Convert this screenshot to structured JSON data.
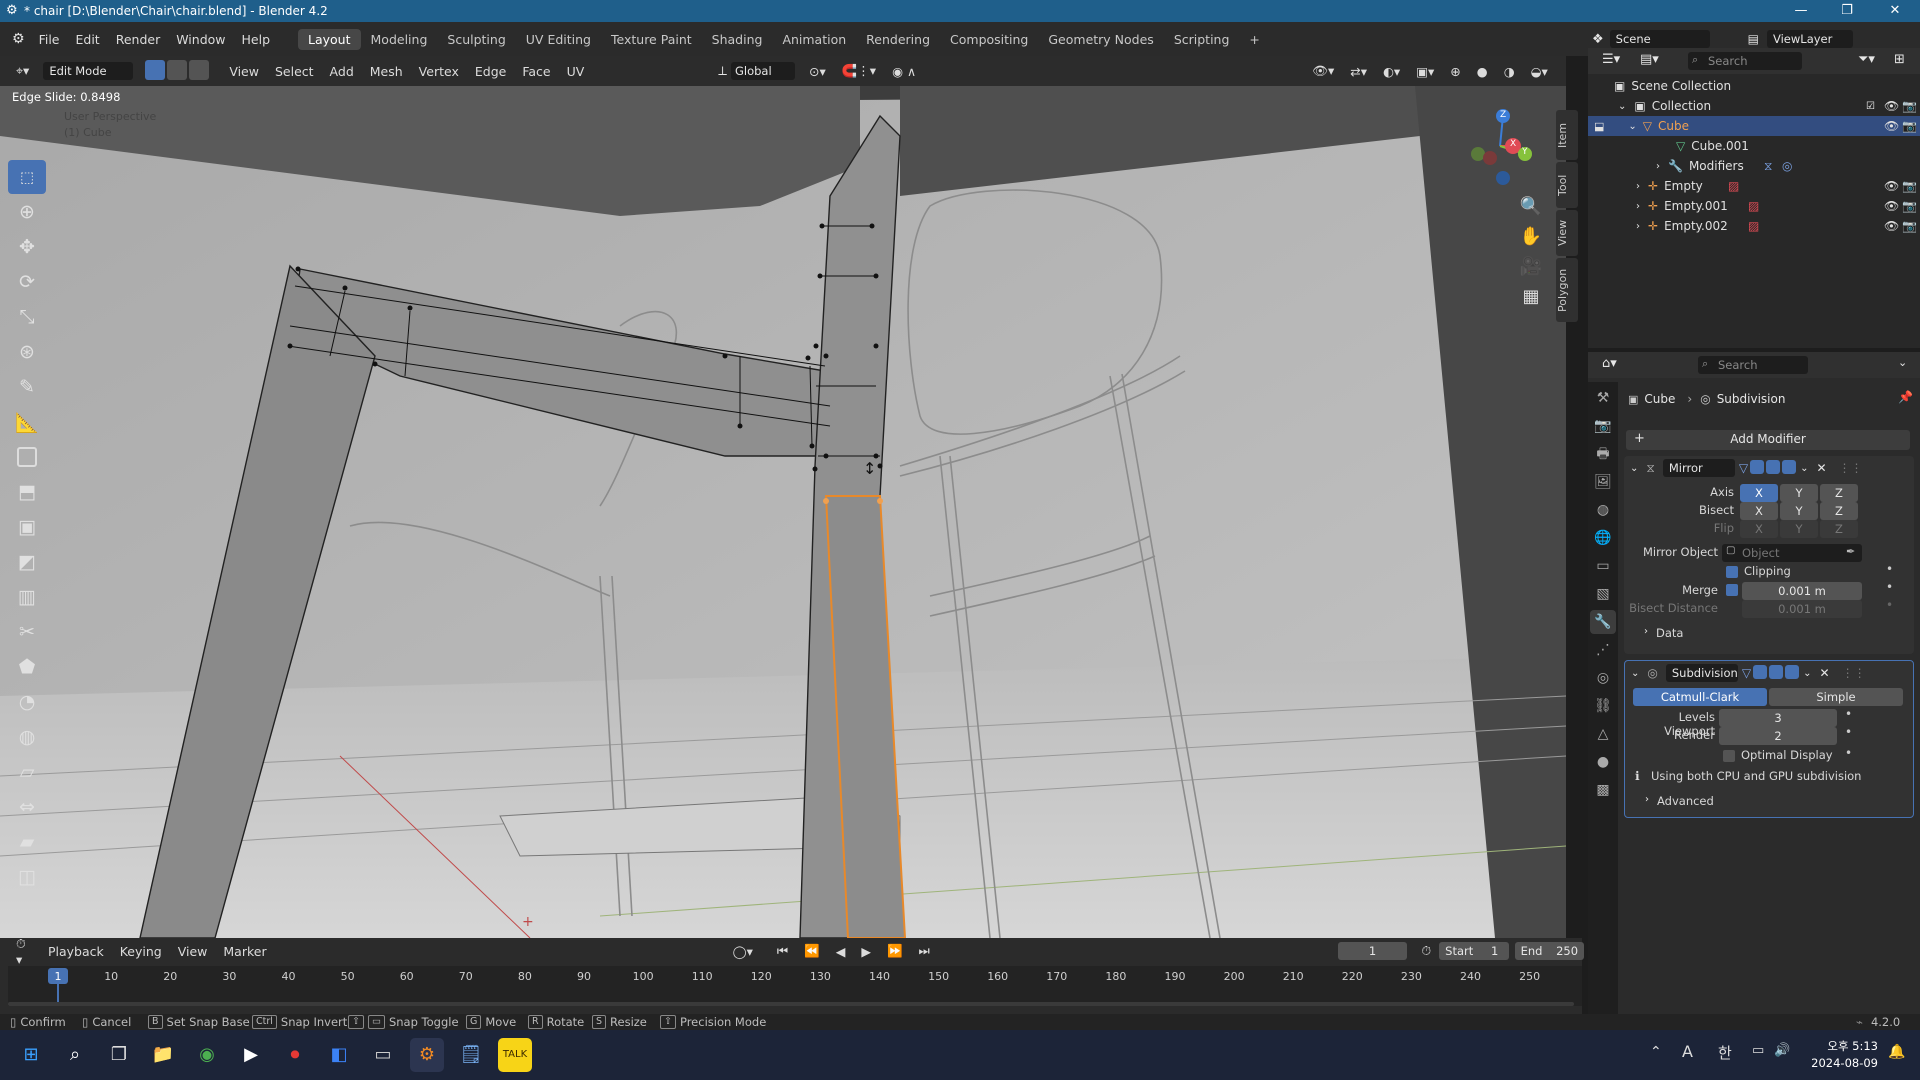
{
  "title_bar": {
    "title": "* chair [D:\\Blender\\Chair\\chair.blend] - Blender 4.2",
    "minimize": "—",
    "maximize": "❐",
    "close": "✕"
  },
  "menu": [
    "File",
    "Edit",
    "Render",
    "Window",
    "Help"
  ],
  "workspaces": [
    "Layout",
    "Modeling",
    "Sculpting",
    "UV Editing",
    "Texture Paint",
    "Shading",
    "Animation",
    "Rendering",
    "Compositing",
    "Geometry Nodes",
    "Scripting"
  ],
  "add_workspace": "+",
  "scene": {
    "label": "Scene",
    "viewlayer": "ViewLayer"
  },
  "viewport_header": {
    "mode": "Edit Mode",
    "menus": [
      "View",
      "Select",
      "Add",
      "Mesh",
      "Vertex",
      "Edge",
      "Face",
      "UV"
    ],
    "transform_orientation": "Global"
  },
  "viewport": {
    "operator_info": "Edge Slide: 0.8498",
    "view_name": "User Perspective",
    "object_label": "(1) Cube",
    "side_tabs": [
      "Item",
      "Tool",
      "View",
      "Polygon"
    ],
    "gizmo": {
      "x": "X",
      "y": "Y",
      "z": "Z"
    }
  },
  "outliner": {
    "search_placeholder": "Search",
    "scene_collection": "Scene Collection",
    "collection": "Collection",
    "items": [
      {
        "name": "Cube",
        "selected": true
      },
      {
        "name": "Cube.001"
      },
      {
        "name": "Modifiers"
      },
      {
        "name": "Empty"
      },
      {
        "name": "Empty.001"
      },
      {
        "name": "Empty.002"
      }
    ]
  },
  "properties": {
    "search_placeholder": "Search",
    "breadcrumb_object": "Cube",
    "breadcrumb_modifier": "Subdivision",
    "add_modifier": "Add Modifier",
    "mirror": {
      "name": "Mirror",
      "axis_label": "Axis",
      "bisect_label": "Bisect",
      "flip_label": "Flip",
      "axes": [
        "X",
        "Y",
        "Z"
      ],
      "mirror_object_label": "Mirror Object",
      "mirror_object_placeholder": "Object",
      "clipping_label": "Clipping",
      "merge_label": "Merge",
      "merge_value": "0.001 m",
      "bisect_distance_label": "Bisect Distance",
      "bisect_distance_value": "0.001 m",
      "data_label": "Data"
    },
    "subdivision": {
      "name": "Subdivision",
      "catmull": "Catmull-Clark",
      "simple": "Simple",
      "levels_viewport_label": "Levels Viewport",
      "levels_viewport": "3",
      "render_label": "Render",
      "render_value": "2",
      "optimal_display": "Optimal Display",
      "info": "Using both CPU and GPU subdivision",
      "advanced": "Advanced"
    }
  },
  "timeline": {
    "menus": [
      "Playback",
      "Keying",
      "View",
      "Marker"
    ],
    "current_frame": "1",
    "start_label": "Start",
    "start": "1",
    "end_label": "End",
    "end": "250",
    "ruler": [
      "1",
      "10",
      "20",
      "30",
      "40",
      "50",
      "60",
      "70",
      "80",
      "90",
      "100",
      "110",
      "120",
      "130",
      "140",
      "150",
      "160",
      "170",
      "180",
      "190",
      "200",
      "210",
      "220",
      "230",
      "240",
      "250"
    ]
  },
  "status_bar": {
    "items": [
      {
        "key": "",
        "label": "Confirm"
      },
      {
        "key": "",
        "label": "Cancel"
      },
      {
        "key": "B",
        "label": "Set Snap Base"
      },
      {
        "key": "Ctrl",
        "label": "Snap Invert"
      },
      {
        "key": "⇧",
        "label": "Snap Toggle"
      },
      {
        "key": "G",
        "label": "Move"
      },
      {
        "key": "R",
        "label": "Rotate"
      },
      {
        "key": "S",
        "label": "Resize"
      },
      {
        "key": "⇧",
        "label": "Precision Mode"
      }
    ],
    "version": "4.2.0"
  },
  "taskbar": {
    "ime": "A",
    "ime2": "한",
    "time": "오후 5:13",
    "date": "2024-08-09"
  },
  "colors": {
    "accent": "#4772b3",
    "titlebar": "#1f5f8b",
    "selection_orange": "#f0a050"
  }
}
